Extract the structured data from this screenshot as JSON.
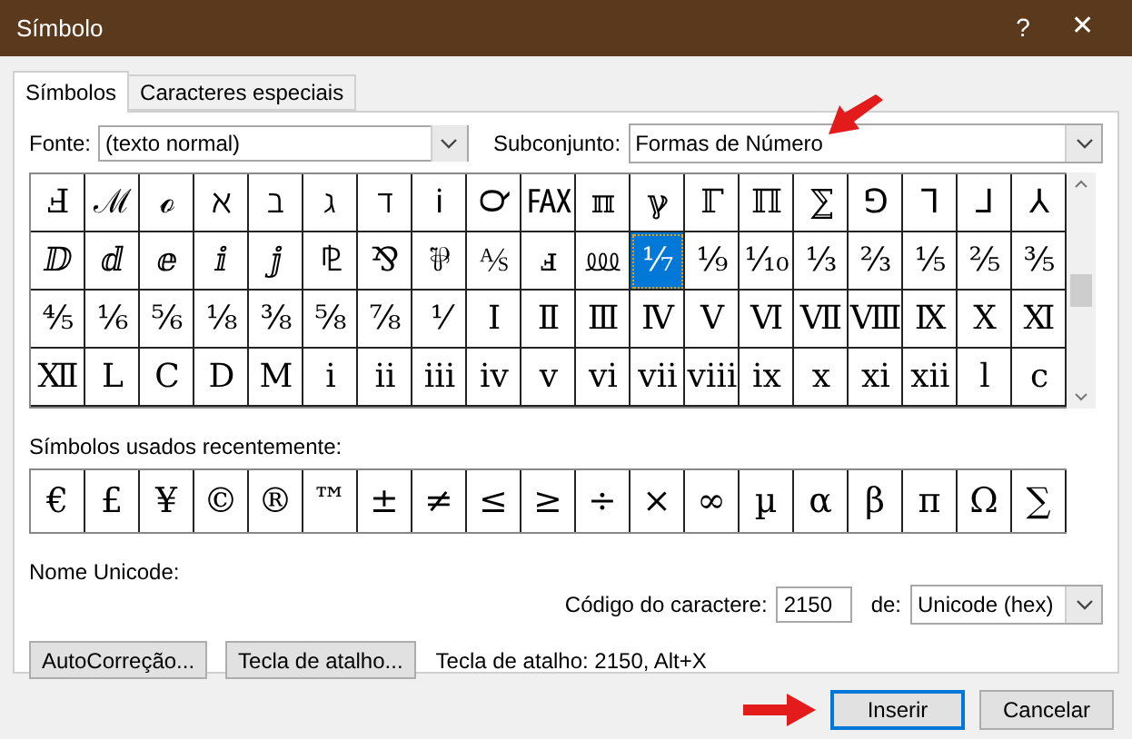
{
  "window": {
    "title": "Símbolo",
    "help": "?",
    "close": "✕"
  },
  "tabs": [
    {
      "label": "Símbolos",
      "selected": true
    },
    {
      "label": "Caracteres especiais",
      "selected": false
    }
  ],
  "font": {
    "label": "Fonte:",
    "value": "(texto normal)"
  },
  "subset": {
    "label": "Subconjunto:",
    "value": "Formas de Número"
  },
  "symbol_grid": [
    [
      {
        "char": "Ⅎ",
        "selected": false
      },
      {
        "char": "ℳ",
        "selected": false
      },
      {
        "char": "ℴ",
        "selected": false
      },
      {
        "char": "ℵ",
        "selected": false
      },
      {
        "char": "ℶ",
        "selected": false
      },
      {
        "char": "ℷ",
        "selected": false
      },
      {
        "char": "ℸ",
        "selected": false
      },
      {
        "char": "ℹ",
        "selected": false
      },
      {
        "char": "℺",
        "selected": false
      },
      {
        "char": "℻",
        "selected": false
      },
      {
        "char": "ℼ",
        "selected": false
      },
      {
        "char": "ℽ",
        "selected": false
      },
      {
        "char": "ℾ",
        "selected": false
      },
      {
        "char": "ℿ",
        "selected": false
      },
      {
        "char": "⅀",
        "selected": false
      },
      {
        "char": "⅁",
        "selected": false
      },
      {
        "char": "⅂",
        "selected": false
      },
      {
        "char": "⅃",
        "selected": false
      },
      {
        "char": "⅄",
        "selected": false
      }
    ],
    [
      {
        "char": "ⅅ",
        "selected": false
      },
      {
        "char": "ⅆ",
        "selected": false
      },
      {
        "char": "ⅇ",
        "selected": false
      },
      {
        "char": "ⅈ",
        "selected": false
      },
      {
        "char": "ⅉ",
        "selected": false
      },
      {
        "char": "⅊",
        "selected": false
      },
      {
        "char": "⅋",
        "selected": false
      },
      {
        "char": "⅌",
        "selected": false
      },
      {
        "char": "⅍",
        "selected": false
      },
      {
        "char": "ⅎ",
        "selected": false
      },
      {
        "char": "⅏",
        "selected": false
      },
      {
        "char": "⅐",
        "selected": true
      },
      {
        "char": "⅑",
        "selected": false
      },
      {
        "char": "⅒",
        "selected": false
      },
      {
        "char": "⅓",
        "selected": false
      },
      {
        "char": "⅔",
        "selected": false
      },
      {
        "char": "⅕",
        "selected": false
      },
      {
        "char": "⅖",
        "selected": false
      },
      {
        "char": "⅗",
        "selected": false
      }
    ],
    [
      {
        "char": "⅘",
        "selected": false
      },
      {
        "char": "⅙",
        "selected": false
      },
      {
        "char": "⅚",
        "selected": false
      },
      {
        "char": "⅛",
        "selected": false
      },
      {
        "char": "⅜",
        "selected": false
      },
      {
        "char": "⅝",
        "selected": false
      },
      {
        "char": "⅞",
        "selected": false
      },
      {
        "char": "⅟",
        "selected": false
      },
      {
        "char": "Ⅰ",
        "selected": false
      },
      {
        "char": "Ⅱ",
        "selected": false
      },
      {
        "char": "Ⅲ",
        "selected": false
      },
      {
        "char": "Ⅳ",
        "selected": false
      },
      {
        "char": "Ⅴ",
        "selected": false
      },
      {
        "char": "Ⅵ",
        "selected": false
      },
      {
        "char": "Ⅶ",
        "selected": false
      },
      {
        "char": "Ⅷ",
        "selected": false
      },
      {
        "char": "Ⅸ",
        "selected": false
      },
      {
        "char": "Ⅹ",
        "selected": false
      },
      {
        "char": "Ⅺ",
        "selected": false
      }
    ],
    [
      {
        "char": "Ⅻ",
        "selected": false
      },
      {
        "char": "Ⅼ",
        "selected": false
      },
      {
        "char": "Ⅽ",
        "selected": false
      },
      {
        "char": "Ⅾ",
        "selected": false
      },
      {
        "char": "Ⅿ",
        "selected": false
      },
      {
        "char": "ⅰ",
        "selected": false
      },
      {
        "char": "ⅱ",
        "selected": false
      },
      {
        "char": "ⅲ",
        "selected": false
      },
      {
        "char": "ⅳ",
        "selected": false
      },
      {
        "char": "ⅴ",
        "selected": false
      },
      {
        "char": "ⅵ",
        "selected": false
      },
      {
        "char": "ⅶ",
        "selected": false
      },
      {
        "char": "ⅷ",
        "selected": false
      },
      {
        "char": "ⅸ",
        "selected": false
      },
      {
        "char": "ⅹ",
        "selected": false
      },
      {
        "char": "ⅺ",
        "selected": false
      },
      {
        "char": "ⅻ",
        "selected": false
      },
      {
        "char": "ⅼ",
        "selected": false
      },
      {
        "char": "ⅽ",
        "selected": false
      }
    ]
  ],
  "recent": {
    "label": "Símbolos usados recentemente:",
    "symbols": [
      "€",
      "£",
      "¥",
      "©",
      "®",
      "™",
      "±",
      "≠",
      "≤",
      "≥",
      "÷",
      "×",
      "∞",
      "µ",
      "α",
      "β",
      "π",
      "Ω",
      "∑"
    ]
  },
  "unicode_name": {
    "label": "Nome Unicode:"
  },
  "char_code": {
    "label": "Código do caractere:",
    "value": "2150",
    "from_label": "de:",
    "from_value": "Unicode (hex)"
  },
  "buttons": [
    "AutoCorreção...",
    "Tecla de atalho..."
  ],
  "shortcut_text": "Tecla de atalho: 2150, Alt+X",
  "footer_buttons": [
    {
      "label": "Inserir",
      "default": true
    },
    {
      "label": "Cancelar",
      "default": false
    }
  ]
}
